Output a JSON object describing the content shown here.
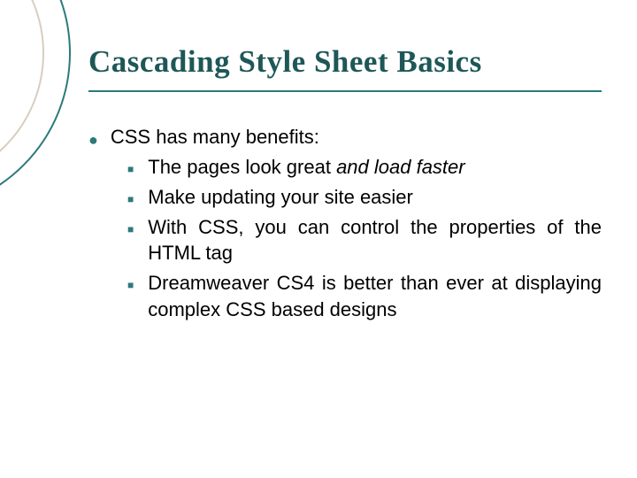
{
  "title": "Cascading Style Sheet Basics",
  "body": {
    "lead": "CSS has many benefits:",
    "items": [
      {
        "plain": "The pages look great ",
        "italic": "and load faster"
      },
      {
        "plain": "Make updating your site easier"
      },
      {
        "plain": "With CSS, you can control the properties of the HTML tag"
      },
      {
        "plain": "Dreamweaver CS4 is better than ever at displaying complex CSS based designs"
      }
    ]
  }
}
